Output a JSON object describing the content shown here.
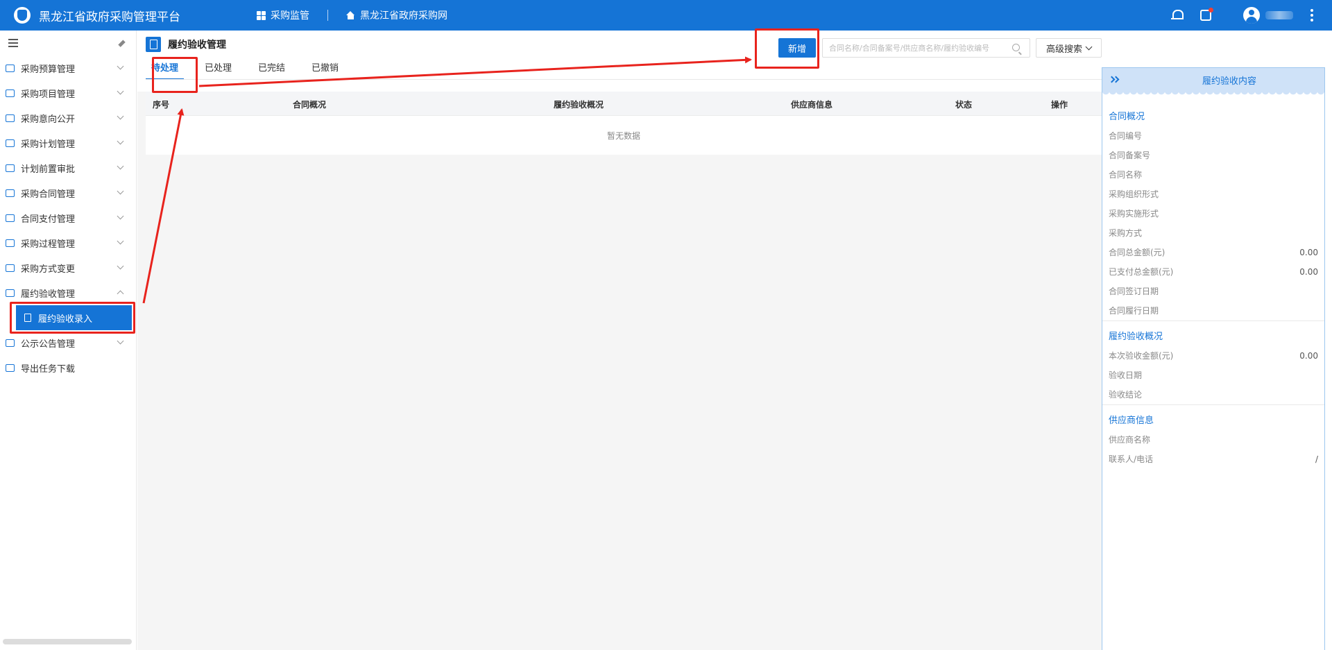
{
  "header": {
    "app_title": "黑龙江省政府采购管理平台",
    "nav": [
      {
        "label": "采购监管",
        "icon": "grid-icon"
      },
      {
        "label": "黑龙江省政府采购网",
        "icon": "home-icon"
      }
    ],
    "icons": [
      "bell-icon",
      "task-icon",
      "user-avatar-icon",
      "more-vertical-icon"
    ]
  },
  "sidebar": {
    "items": [
      {
        "label": "采购预算管理",
        "expanded": false
      },
      {
        "label": "采购项目管理",
        "expanded": false
      },
      {
        "label": "采购意向公开",
        "expanded": false
      },
      {
        "label": "采购计划管理",
        "expanded": false
      },
      {
        "label": "计划前置审批",
        "expanded": false
      },
      {
        "label": "采购合同管理",
        "expanded": false
      },
      {
        "label": "合同支付管理",
        "expanded": false
      },
      {
        "label": "采购过程管理",
        "expanded": false
      },
      {
        "label": "采购方式变更",
        "expanded": false
      },
      {
        "label": "履约验收管理",
        "expanded": true
      },
      {
        "label": "公示公告管理",
        "expanded": false
      },
      {
        "label": "导出任务下载",
        "expanded": false
      }
    ],
    "active_sub_item": "履约验收录入"
  },
  "main": {
    "page_title": "履约验收管理",
    "tabs": [
      {
        "label": "待处理",
        "active": true
      },
      {
        "label": "已处理",
        "active": false
      },
      {
        "label": "已完结",
        "active": false
      },
      {
        "label": "已撤销",
        "active": false
      }
    ],
    "new_button": "新增",
    "search_placeholder": "合同名称/合同备案号/供应商名称/履约验收编号",
    "advanced_search": "高级搜索",
    "table": {
      "columns": [
        "序号",
        "合同概况",
        "履约验收概况",
        "供应商信息",
        "状态",
        "操作"
      ],
      "empty_text": "暂无数据"
    }
  },
  "right_panel": {
    "title": "履约验收内容",
    "sections": [
      {
        "title": "合同概况",
        "rows": [
          {
            "label": "合同编号",
            "value": ""
          },
          {
            "label": "合同备案号",
            "value": ""
          },
          {
            "label": "合同名称",
            "value": ""
          },
          {
            "label": "采购组织形式",
            "value": ""
          },
          {
            "label": "采购实施形式",
            "value": ""
          },
          {
            "label": "采购方式",
            "value": ""
          },
          {
            "label": "合同总金额(元)",
            "value": "0.00"
          },
          {
            "label": "已支付总金额(元)",
            "value": "0.00"
          },
          {
            "label": "合同签订日期",
            "value": ""
          },
          {
            "label": "合同履行日期",
            "value": ""
          }
        ]
      },
      {
        "title": "履约验收概况",
        "rows": [
          {
            "label": "本次验收金额(元)",
            "value": "0.00"
          },
          {
            "label": "验收日期",
            "value": ""
          },
          {
            "label": "验收结论",
            "value": ""
          }
        ]
      },
      {
        "title": "供应商信息",
        "rows": [
          {
            "label": "供应商名称",
            "value": ""
          },
          {
            "label": "联系人/电话",
            "value": "/"
          }
        ]
      }
    ]
  },
  "colors": {
    "primary": "#1574d6",
    "annotation_red": "#e8231d",
    "panel_header_bg": "#cfe2f8"
  }
}
